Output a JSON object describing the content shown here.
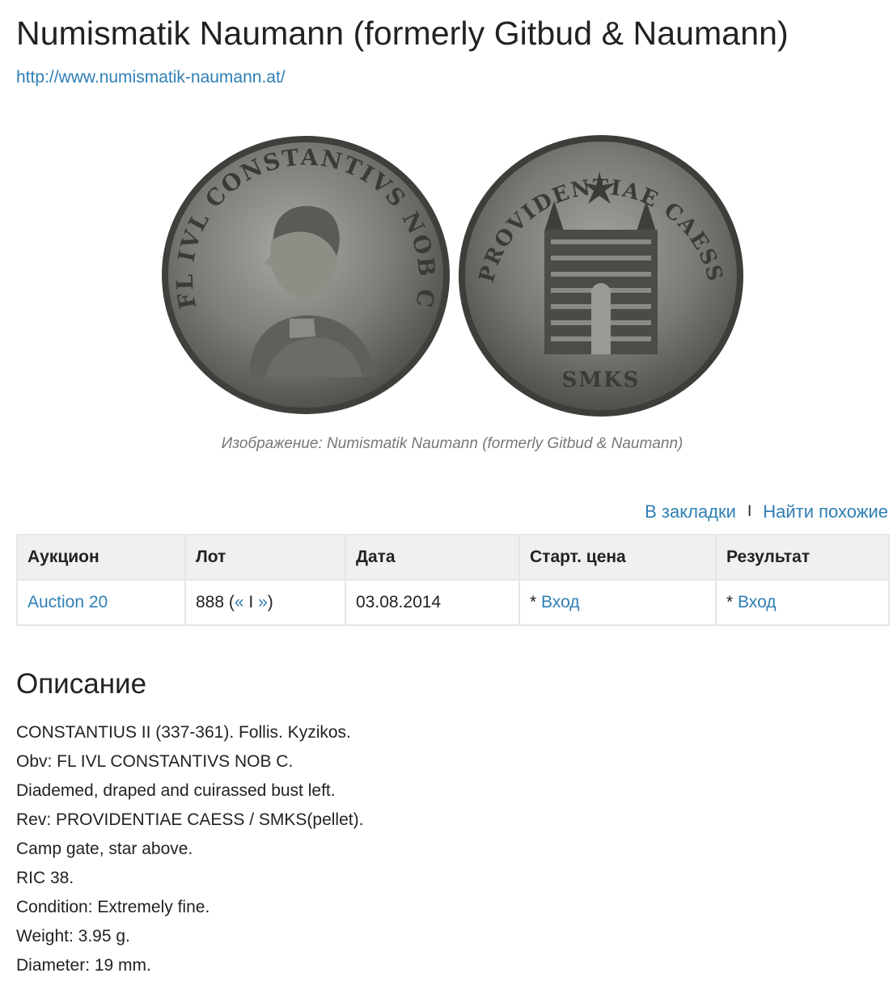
{
  "header": {
    "title": "Numismatik Naumann (formerly Gitbud & Naumann)",
    "url": "http://www.numismatik-naumann.at/"
  },
  "image": {
    "caption": "Изображение: Numismatik Naumann (formerly Gitbud & Naumann)",
    "obverse_legend": "FL IVL CONSTANTIVS NOB C",
    "reverse_legend": "PROVIDENTIAE CAESS",
    "exergue": "SMKS"
  },
  "actions": {
    "bookmark": "В закладки",
    "separator": "I",
    "find_similar": "Найти похожие"
  },
  "table": {
    "headers": [
      "Аукцион",
      "Лот",
      "Дата",
      "Старт. цена",
      "Результат"
    ],
    "auction": "Auction 20",
    "lot": "888",
    "lot_prev": "«",
    "lot_sep": "I",
    "lot_next": "»",
    "date": "03.08.2014",
    "start_price_prefix": "*",
    "start_price_link": "Вход",
    "result_prefix": "*",
    "result_link": "Вход"
  },
  "description": {
    "title": "Описание",
    "lines": [
      "CONSTANTIUS II (337-361). Follis. Kyzikos.",
      "Obv: FL IVL CONSTANTIVS NOB C.",
      "Diademed, draped and cuirassed bust left.",
      "Rev: PROVIDENTIAE CAESS / SMKS(pellet).",
      "Camp gate, star above.",
      "RIC 38.",
      "Condition: Extremely fine.",
      "Weight: 3.95 g.",
      "Diameter: 19 mm."
    ]
  },
  "colors": {
    "link": "#2f7fb5",
    "table_header_bg": "#f0f0f0",
    "coin_metal": "#7d7d78"
  }
}
